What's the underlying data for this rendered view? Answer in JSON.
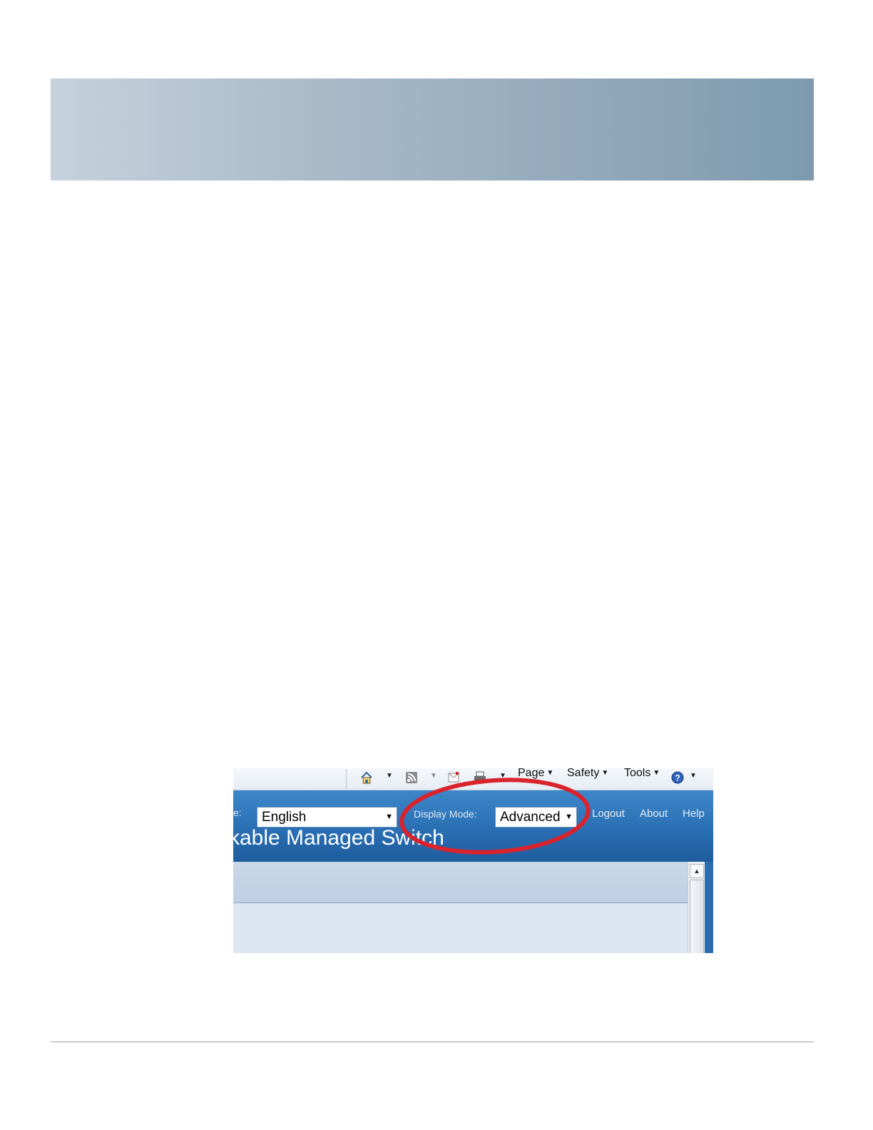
{
  "ie_toolbar": {
    "icons": [
      "home-icon",
      "feeds-icon",
      "read-mail-icon",
      "print-icon",
      "help-icon"
    ],
    "menus": {
      "page": "Page",
      "safety": "Safety",
      "tools": "Tools"
    }
  },
  "app_header": {
    "language_label_fragment": "e:",
    "language_value": "English",
    "display_mode_label": "Display Mode:",
    "display_mode_value": "Advanced",
    "links": {
      "logout": "Logout",
      "about": "About",
      "help": "Help"
    },
    "title_fragment": "kable Managed Switch"
  },
  "colors": {
    "highlight": "#d9232d",
    "header_blue": "#2a6fb4"
  }
}
